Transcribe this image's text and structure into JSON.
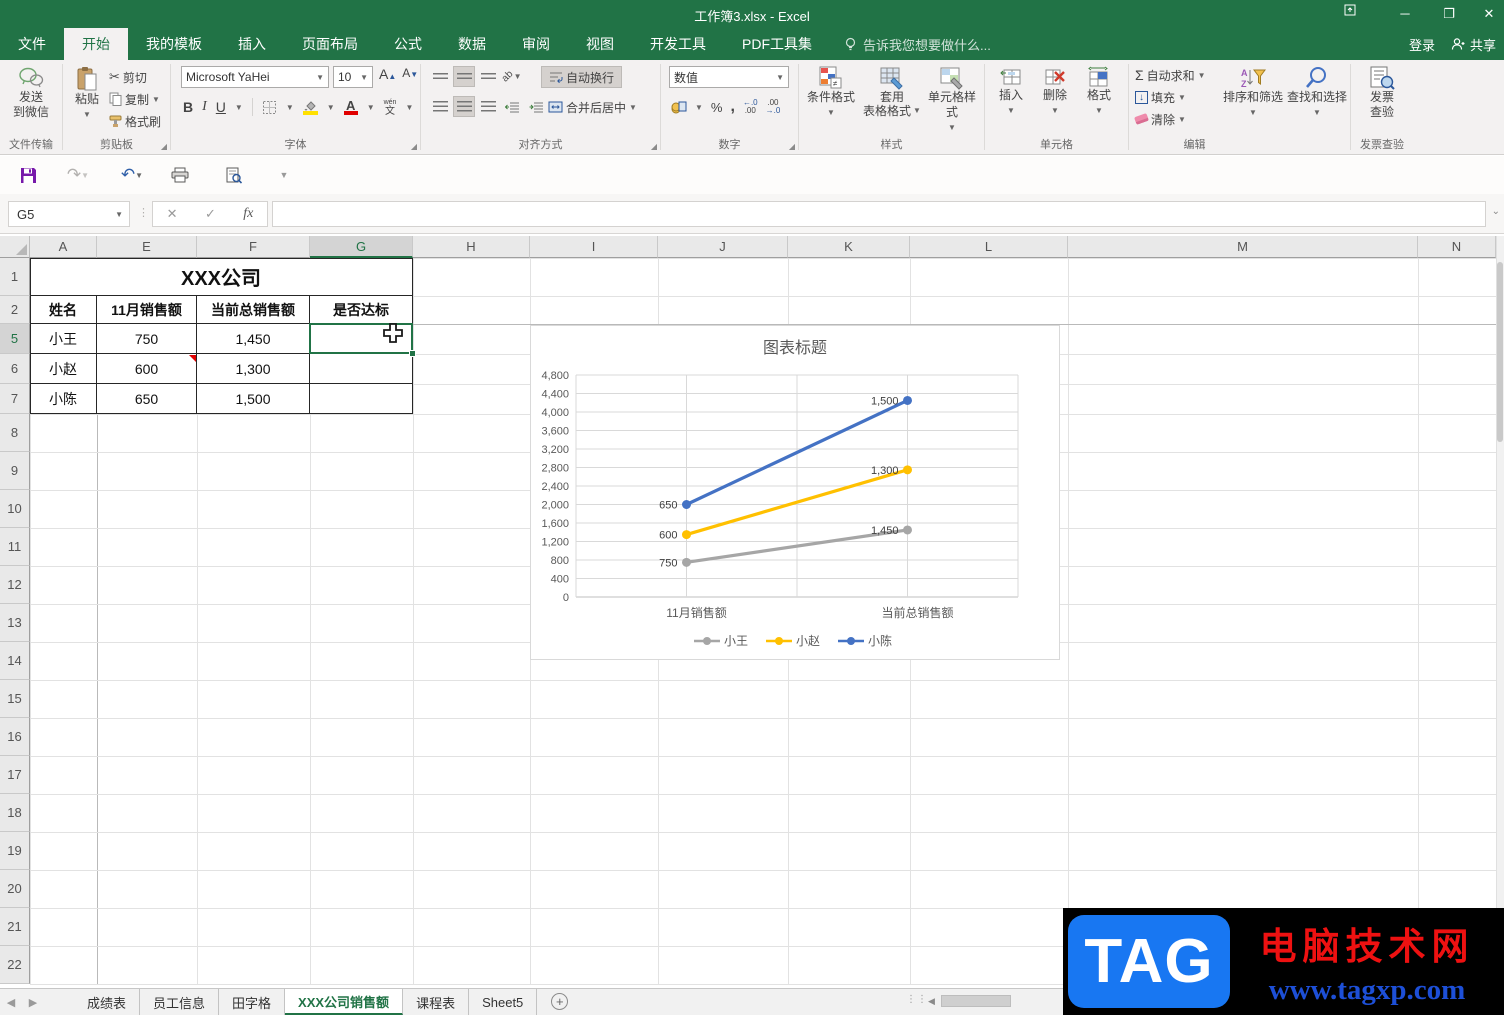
{
  "titlebar": {
    "title": "工作簿3.xlsx - Excel"
  },
  "menu": {
    "tabs": [
      {
        "label": "文件",
        "active": false
      },
      {
        "label": "开始",
        "active": true
      },
      {
        "label": "我的模板",
        "active": false
      },
      {
        "label": "插入",
        "active": false
      },
      {
        "label": "页面布局",
        "active": false
      },
      {
        "label": "公式",
        "active": false
      },
      {
        "label": "数据",
        "active": false
      },
      {
        "label": "审阅",
        "active": false
      },
      {
        "label": "视图",
        "active": false
      },
      {
        "label": "开发工具",
        "active": false
      },
      {
        "label": "PDF工具集",
        "active": false
      }
    ],
    "tell_me": "告诉我您想要做什么...",
    "signin": "登录",
    "share": "共享"
  },
  "ribbon": {
    "file_transfer": {
      "group": "文件传输",
      "send_line1": "发送",
      "send_line2": "到微信"
    },
    "clipboard": {
      "group": "剪贴板",
      "paste": "粘贴",
      "cut": "剪切",
      "copy": "复制",
      "format_painter": "格式刷"
    },
    "font": {
      "group": "字体",
      "family": "Microsoft YaHei",
      "size": "10",
      "bold": "B",
      "italic": "I",
      "underline": "U",
      "wen_top": "wén",
      "wen_bottom": "文"
    },
    "alignment": {
      "group": "对齐方式",
      "wrap": "自动换行",
      "merge": "合并后居中"
    },
    "number": {
      "group": "数字",
      "format": "数值",
      "percent": "%",
      "comma": ",",
      "inc_dec": "←.0 .00",
      "dec_dec": ".00 →.0"
    },
    "styles": {
      "group": "样式",
      "conditional": "条件格式",
      "table_line1": "套用",
      "table_line2": "表格格式",
      "cell": "单元格样式"
    },
    "cells": {
      "group": "单元格",
      "insert": "插入",
      "delete": "删除",
      "format": "格式"
    },
    "editing": {
      "group": "编辑",
      "sigma": "Σ",
      "autosum": "自动求和",
      "fill": "填充",
      "clear": "清除",
      "sort": "排序和筛选",
      "find": "查找和选择"
    },
    "invoice": {
      "group": "发票查验",
      "line1": "发票",
      "line2": "查验"
    }
  },
  "formula_bar": {
    "name_box": "G5",
    "fx": "fx",
    "value": ""
  },
  "grid": {
    "columns": [
      "A",
      "E",
      "F",
      "G",
      "H",
      "I",
      "J",
      "K",
      "L",
      "M",
      "N"
    ],
    "selected_column": "G",
    "rows": [
      "1",
      "2",
      "5",
      "6",
      "7",
      "8",
      "9",
      "10",
      "11",
      "12",
      "13",
      "14",
      "15",
      "16",
      "17",
      "18",
      "19",
      "20",
      "21",
      "22"
    ],
    "selected_row": "5",
    "active_cell": "G5"
  },
  "table": {
    "title": "XXX公司",
    "headers": [
      "姓名",
      "11月销售额",
      "当前总销售额",
      "是否达标"
    ],
    "rows": [
      [
        "小王",
        "750",
        "1,450",
        ""
      ],
      [
        "小赵",
        "600",
        "1,300",
        ""
      ],
      [
        "小陈",
        "650",
        "1,500",
        ""
      ]
    ],
    "comment_marker": {
      "row_index": 1,
      "col_index": 1
    }
  },
  "chart_data": {
    "type": "line",
    "stacked": true,
    "title": "图表标题",
    "categories": [
      "11月销售额",
      "当前总销售额"
    ],
    "series": [
      {
        "name": "小王",
        "values": [
          750,
          1450
        ],
        "labels": [
          "750",
          "1,450"
        ],
        "stacked_values": [
          750,
          1450
        ],
        "color": "#a6a6a6"
      },
      {
        "name": "小赵",
        "values": [
          600,
          1300
        ],
        "labels": [
          "600",
          "1,300"
        ],
        "stacked_values": [
          1350,
          2750
        ],
        "color": "#ffc000"
      },
      {
        "name": "小陈",
        "values": [
          650,
          1500
        ],
        "labels": [
          "650",
          "1,500"
        ],
        "stacked_values": [
          2000,
          4250
        ],
        "color": "#4472c4"
      }
    ],
    "ylim": [
      0,
      4800
    ],
    "ytick_step": 400,
    "gridlines": true,
    "legend_position": "bottom",
    "marker": "circle"
  },
  "sheet_bar": {
    "tabs": [
      {
        "label": "成绩表",
        "active": false
      },
      {
        "label": "员工信息",
        "active": false
      },
      {
        "label": "田字格",
        "active": false
      },
      {
        "label": "XXX公司销售额",
        "active": true
      },
      {
        "label": "课程表",
        "active": false
      },
      {
        "label": "Sheet5",
        "active": false
      }
    ],
    "add_label": "+"
  },
  "watermark": {
    "logo": "TAG",
    "site": "电脑技术网",
    "url": "www.tagxp.com"
  },
  "colors": {
    "excel_green": "#217346",
    "series_gray": "#a6a6a6",
    "series_yellow": "#ffc000",
    "series_blue": "#4472c4",
    "comment_red": "#e00000"
  }
}
